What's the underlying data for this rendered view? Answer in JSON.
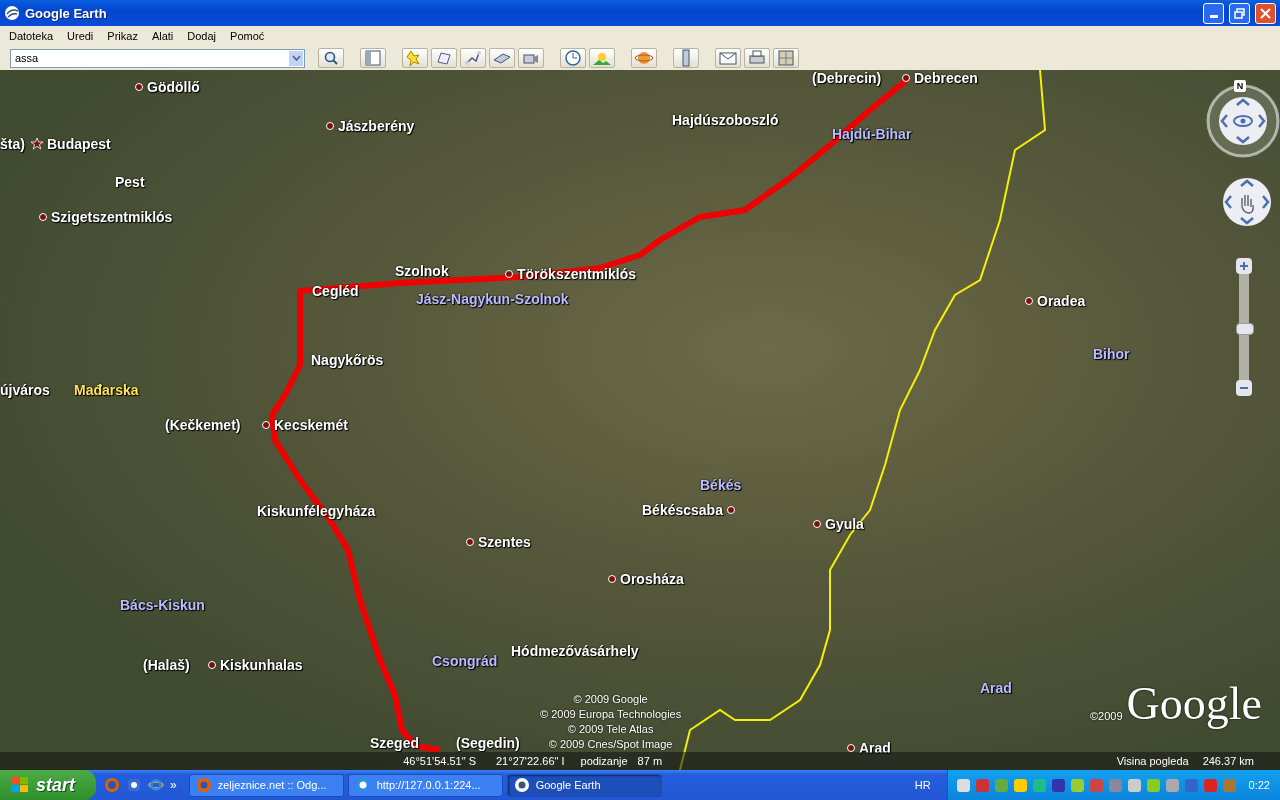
{
  "window": {
    "title": "Google Earth"
  },
  "menu": [
    "Datoteka",
    "Uredi",
    "Prikaz",
    "Alati",
    "Dodaj",
    "Pomoć"
  ],
  "search": {
    "value": "assa"
  },
  "map": {
    "labels": [
      {
        "text": "(Debrecin)",
        "kind": "alias"
      },
      {
        "text": "Debrecen",
        "kind": "city"
      },
      {
        "text": "Gödöllő",
        "kind": "city"
      },
      {
        "text": "šta)",
        "kind": "alias"
      },
      {
        "text": "Budapest",
        "kind": "capital"
      },
      {
        "text": "Jászberény",
        "kind": "city"
      },
      {
        "text": "Hajdúszoboszló",
        "kind": "alias"
      },
      {
        "text": "Hajdú-Bihar",
        "kind": "region"
      },
      {
        "text": "Pest",
        "kind": "alias"
      },
      {
        "text": "Szigetszentmiklós",
        "kind": "city"
      },
      {
        "text": "Cegléd",
        "kind": "alias"
      },
      {
        "text": "Szolnok",
        "kind": "alias"
      },
      {
        "text": "Törökszentmiklós",
        "kind": "city"
      },
      {
        "text": "Jász-Nagykun-Szolnok",
        "kind": "region"
      },
      {
        "text": "Oradea",
        "kind": "city"
      },
      {
        "text": "Bihor",
        "kind": "region"
      },
      {
        "text": "Nagykőrös",
        "kind": "alias"
      },
      {
        "text": "újváros",
        "kind": "alias"
      },
      {
        "text": "Mađarska",
        "kind": "country"
      },
      {
        "text": "(Kečkemet)",
        "kind": "alias"
      },
      {
        "text": "Kecskemét",
        "kind": "city"
      },
      {
        "text": "Békés",
        "kind": "region"
      },
      {
        "text": "Békéscsaba",
        "kind": "city"
      },
      {
        "text": "Gyula",
        "kind": "city"
      },
      {
        "text": "Kiskunfélegyháza",
        "kind": "alias"
      },
      {
        "text": "Szentes",
        "kind": "city"
      },
      {
        "text": "Orosháza",
        "kind": "city"
      },
      {
        "text": "Bács-Kiskun",
        "kind": "region"
      },
      {
        "text": "Csongrád",
        "kind": "region"
      },
      {
        "text": "Hódmezővásárhely",
        "kind": "alias"
      },
      {
        "text": "(Halaš)",
        "kind": "alias"
      },
      {
        "text": "Kiskunhalas",
        "kind": "city"
      },
      {
        "text": "Arad",
        "kind": "region"
      },
      {
        "text": "Szeged",
        "kind": "alias"
      },
      {
        "text": "(Segedin)",
        "kind": "alias"
      },
      {
        "text": "Arad",
        "kind": "city"
      }
    ],
    "attribution": [
      "© 2009 Google",
      "© 2009 Europa Technologies",
      "© 2009 Tele Atlas",
      "© 2009 Cnes/Spot Image"
    ],
    "logo": {
      "year": "©2009",
      "text": "Google"
    },
    "compass_label": "N",
    "zoom": {
      "level": 0.5
    },
    "status": {
      "latitude": "46°51'54.51\" S",
      "longitude": "21°27'22.66\" I",
      "elevation_label": "podizanje",
      "elevation": "87 m",
      "eye_alt_label": "Visina pogleda",
      "eye_alt": "246.37 km"
    }
  },
  "taskbar": {
    "start": "start",
    "more": "»",
    "tasks": [
      {
        "label": "zeljeznice.net :: Odg...",
        "selected": false
      },
      {
        "label": "http://127.0.0.1:224...",
        "selected": false
      },
      {
        "label": "Google Earth",
        "selected": true
      }
    ],
    "language": "HR",
    "clock": "0:22"
  }
}
